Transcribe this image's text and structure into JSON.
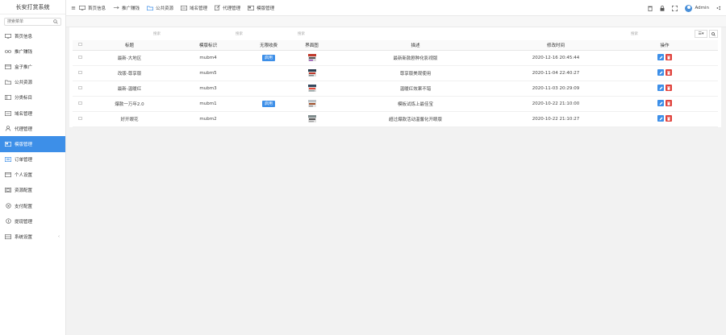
{
  "app": {
    "title": "长安打赏系统"
  },
  "sidebar": {
    "search_placeholder": "搜索菜单",
    "items": [
      {
        "label": "首页信息",
        "icon": "monitor-icon"
      },
      {
        "label": "推广赚钱",
        "icon": "link-icon"
      },
      {
        "label": "盒子推广",
        "icon": "box-icon"
      },
      {
        "label": "公共资源",
        "icon": "folder-icon"
      },
      {
        "label": "分类标目",
        "icon": "category-icon"
      },
      {
        "label": "域名管理",
        "icon": "globe-icon"
      },
      {
        "label": "代理管理",
        "icon": "user-icon"
      },
      {
        "label": "模版管理",
        "icon": "template-icon",
        "active": true
      },
      {
        "label": "订单管理",
        "icon": "order-icon"
      },
      {
        "label": "个人设置",
        "icon": "profile-icon"
      },
      {
        "label": "资源配置",
        "icon": "config-icon"
      },
      {
        "label": "支付配置",
        "icon": "pay-icon"
      },
      {
        "label": "提现管理",
        "icon": "withdraw-icon"
      },
      {
        "label": "系统设置",
        "icon": "settings-icon",
        "has_caret": true
      }
    ]
  },
  "topbar": {
    "nav": [
      {
        "label": "首页信息",
        "icon": "monitor-icon"
      },
      {
        "label": "推广赚钱",
        "icon": "link-icon"
      },
      {
        "label": "公共资源",
        "icon": "folder-icon"
      },
      {
        "label": "域名管理",
        "icon": "globe-icon"
      },
      {
        "label": "代理管理",
        "icon": "user-icon"
      },
      {
        "label": "模版管理",
        "icon": "template-icon"
      }
    ],
    "user_name": "Admin"
  },
  "toolbar": {
    "search_placeholders": [
      "搜索",
      "搜索",
      "搜索",
      "搜索"
    ],
    "columns_button_label": "☰▾"
  },
  "table": {
    "headers": [
      "标题",
      "模版标识",
      "无限收费",
      "界面图",
      "描述",
      "修改时间",
      "操作"
    ],
    "rows": [
      {
        "title": "最新-大地区",
        "code": "mubm4",
        "status": "启用",
        "desc": "最新新款剧种化影视版",
        "time": "2020-12-16 20:45:44"
      },
      {
        "title": "改版-尊享版",
        "code": "mubm5",
        "status": "",
        "desc": "尊享版美观使用",
        "time": "2020-11-04 22:40:27"
      },
      {
        "title": "最新-温暖红",
        "code": "mubm3",
        "status": "",
        "desc": "温暖红效果不错",
        "time": "2020-11-03 20:29:09"
      },
      {
        "title": "爆款一万年2.0",
        "code": "mubm1",
        "status": "启用",
        "desc": "模板试炼上最佳宝",
        "time": "2020-10-22 21:10:00"
      },
      {
        "title": "好开眼花",
        "code": "mubm2",
        "status": "",
        "desc": "超过爆款活动温馨化开眼版",
        "time": "2020-10-22 21:10:27"
      }
    ]
  },
  "colors": {
    "accent": "#3d8fe8",
    "danger": "#e0443e"
  }
}
